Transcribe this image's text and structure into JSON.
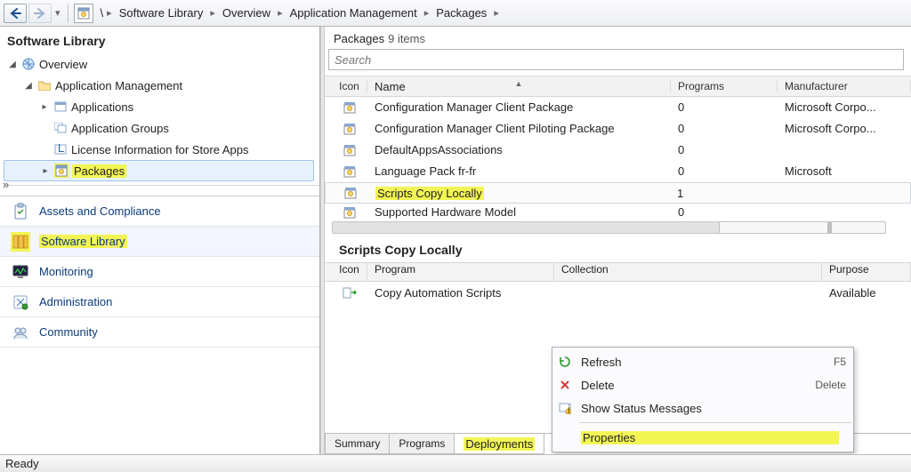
{
  "breadcrumb": {
    "segments": [
      "Software Library",
      "Overview",
      "Application Management",
      "Packages"
    ]
  },
  "nav_tree": {
    "title": "Software Library",
    "overview_label": "Overview",
    "app_mgmt_label": "Application Management",
    "items": [
      "Applications",
      "Application Groups",
      "License Information for Store Apps",
      "Packages"
    ]
  },
  "workspaces": [
    {
      "label": "Assets and Compliance"
    },
    {
      "label": "Software Library"
    },
    {
      "label": "Monitoring"
    },
    {
      "label": "Administration"
    },
    {
      "label": "Community"
    }
  ],
  "packages": {
    "title": "Packages",
    "count": "9 items",
    "search_placeholder": "Search",
    "columns": {
      "icon": "Icon",
      "name": "Name",
      "programs": "Programs",
      "manufacturer": "Manufacturer"
    },
    "rows": [
      {
        "name": "Configuration Manager Client Package",
        "programs": "0",
        "manufacturer": "Microsoft Corpo..."
      },
      {
        "name": "Configuration Manager Client Piloting Package",
        "programs": "0",
        "manufacturer": "Microsoft Corpo..."
      },
      {
        "name": "DefaultAppsAssociations",
        "programs": "0",
        "manufacturer": ""
      },
      {
        "name": "Language Pack fr-fr",
        "programs": "0",
        "manufacturer": "Microsoft"
      },
      {
        "name": "Scripts Copy Locally",
        "programs": "1",
        "manufacturer": ""
      },
      {
        "name": "Supported Hardware Model",
        "programs": "0",
        "manufacturer": ""
      }
    ]
  },
  "detail": {
    "title": "Scripts Copy Locally",
    "columns": {
      "icon": "Icon",
      "program": "Program",
      "collection": "Collection",
      "purpose": "Purpose"
    },
    "row": {
      "program": "Copy Automation Scripts",
      "collection": "",
      "purpose": "Available"
    },
    "tabs": [
      "Summary",
      "Programs",
      "Deployments"
    ]
  },
  "context_menu": {
    "items": [
      {
        "label": "Refresh",
        "accel": "F5",
        "icon": "refresh"
      },
      {
        "label": "Delete",
        "accel": "Delete",
        "icon": "delete"
      },
      {
        "label": "Show Status Messages",
        "accel": "",
        "icon": "status"
      },
      {
        "label": "Properties",
        "accel": "",
        "icon": ""
      }
    ]
  },
  "status_bar": "Ready"
}
